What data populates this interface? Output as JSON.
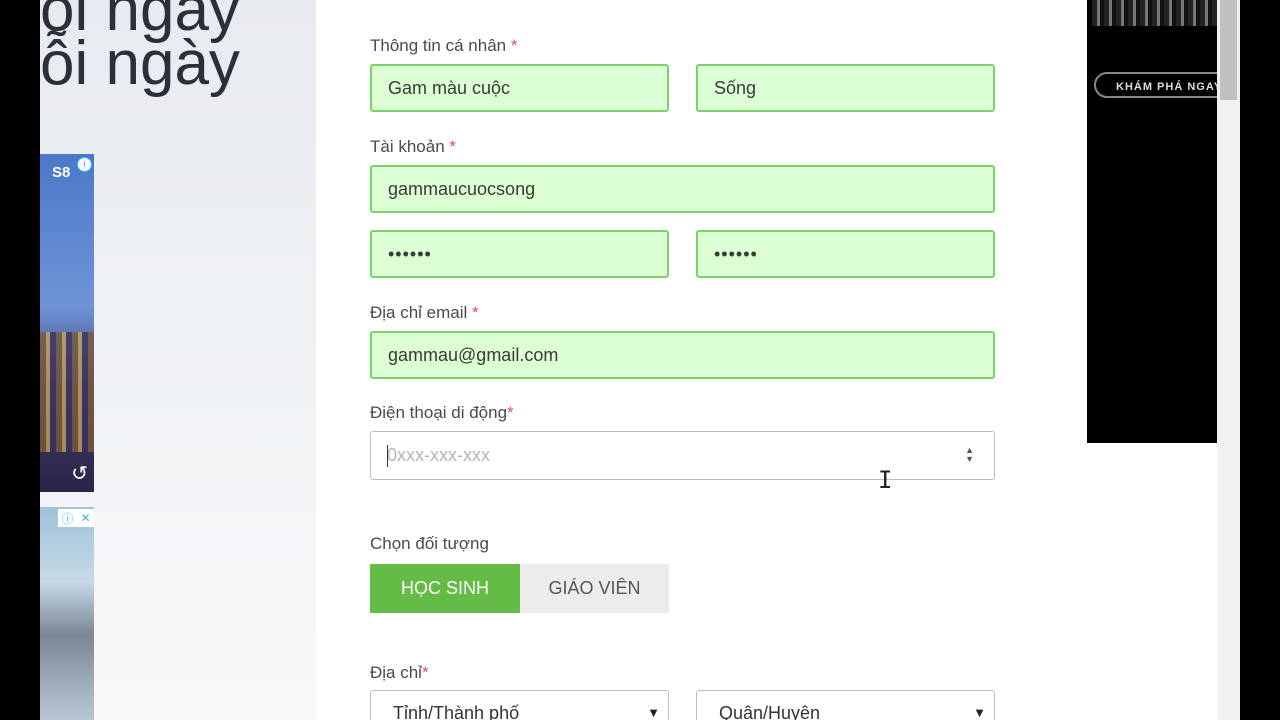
{
  "banner": {
    "line1": "ỗi ngày",
    "line2": "ỗi ngày"
  },
  "ads": {
    "left_top": {
      "brand": "S8",
      "info_icon": "info-icon",
      "refresh_icon": "refresh-icon"
    },
    "left_bottom": {
      "info_icon": "info-icon",
      "close_icon": "close-icon"
    },
    "right": {
      "cta": "KHÁM PHÁ NGAY"
    }
  },
  "form": {
    "personal": {
      "label": "Thông tin cá nhân",
      "required": "*",
      "first_name": "Gam màu cuộc",
      "last_name": "Sống"
    },
    "account": {
      "label": "Tài khoản",
      "required": "*",
      "username": "gammaucuocsong",
      "password": "••••••",
      "password_confirm": "••••••"
    },
    "email": {
      "label": "Địa chỉ email",
      "required": "*",
      "value": "gammau@gmail.com"
    },
    "phone": {
      "label": "Điện thoại di động",
      "required": "*",
      "placeholder": "0xxx-xxx-xxx",
      "value": ""
    },
    "role": {
      "label": "Chọn đối tượng",
      "options": [
        "HỌC SINH",
        "GIÁO VIÊN"
      ],
      "selected": "HỌC SINH"
    },
    "address": {
      "label": "Địa chỉ",
      "required": "*",
      "province_selected": "Tỉnh/Thành phố",
      "district_selected": "Quận/Huyện"
    }
  },
  "colors": {
    "accent": "#64bb46",
    "valid_bg": "#dcffd4",
    "valid_border": "#7ad36a",
    "required": "#d9534f"
  }
}
